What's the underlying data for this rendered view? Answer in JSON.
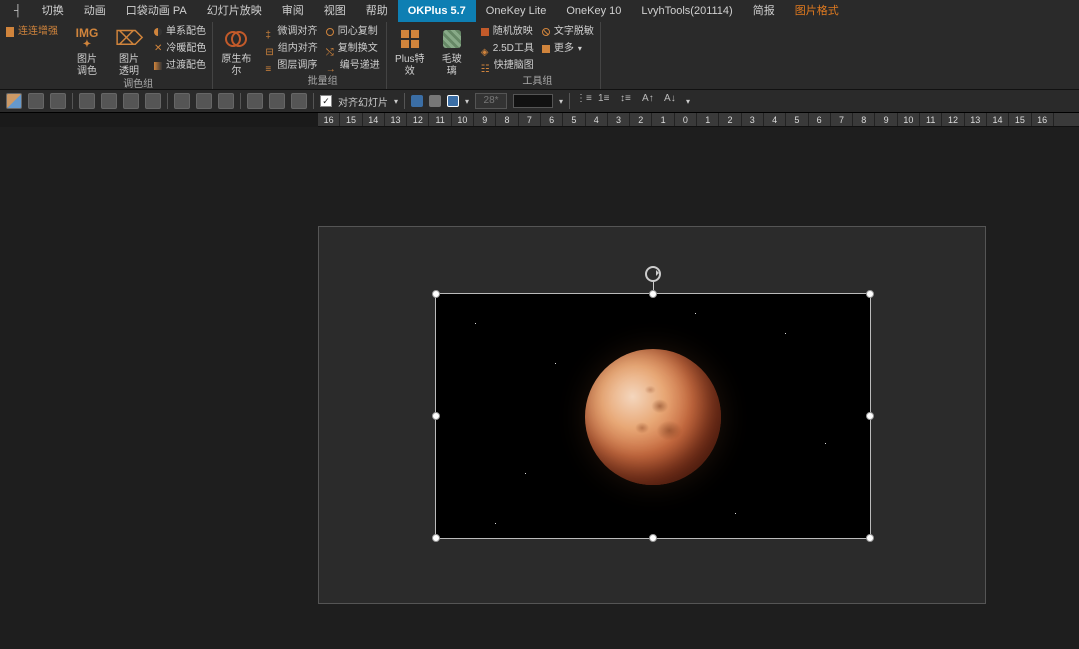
{
  "menu": {
    "items": [
      "切换",
      "动画",
      "口袋动画 PA",
      "幻灯片放映",
      "审阅",
      "视图",
      "帮助",
      "OKPlus 5.7",
      "OneKey Lite",
      "OneKey 10",
      "LvyhTools(201114)",
      "简报",
      "图片格式"
    ],
    "active_index": 7
  },
  "ribbon": {
    "enhance_btn": "连连增强",
    "group_color": {
      "tint_label": "图片\n调色",
      "transparent_label": "图片\n透明",
      "items": [
        "单系配色",
        "冷暖配色",
        "过渡配色"
      ],
      "caption": "调色组"
    },
    "group_origin": {
      "label": "原生布\n尔"
    },
    "group_batch": {
      "items_a": [
        "微调对齐",
        "组内对齐",
        "图层调序"
      ],
      "items_b": [
        "同心复制",
        "复制换文",
        "编号递进"
      ],
      "caption": "批量组"
    },
    "group_effect": {
      "plus_label": "Plus特\n效",
      "glass_label": "毛玻\n璃"
    },
    "group_tools": {
      "items_a": [
        "随机放映",
        "2.5D工具",
        "快捷脑图"
      ],
      "items_b": [
        "文字脱敏",
        "更多"
      ],
      "caption": "工具组"
    }
  },
  "quickbar": {
    "align_label": "对齐幻灯片",
    "fontsize": "28*"
  },
  "ruler": {
    "labels": [
      "16",
      "15",
      "14",
      "13",
      "12",
      "11",
      "10",
      "9",
      "8",
      "7",
      "6",
      "5",
      "4",
      "3",
      "2",
      "1",
      "0",
      "1",
      "2",
      "3",
      "4",
      "5",
      "6",
      "7",
      "8",
      "9",
      "10",
      "11",
      "12",
      "13",
      "14",
      "15",
      "16"
    ]
  }
}
